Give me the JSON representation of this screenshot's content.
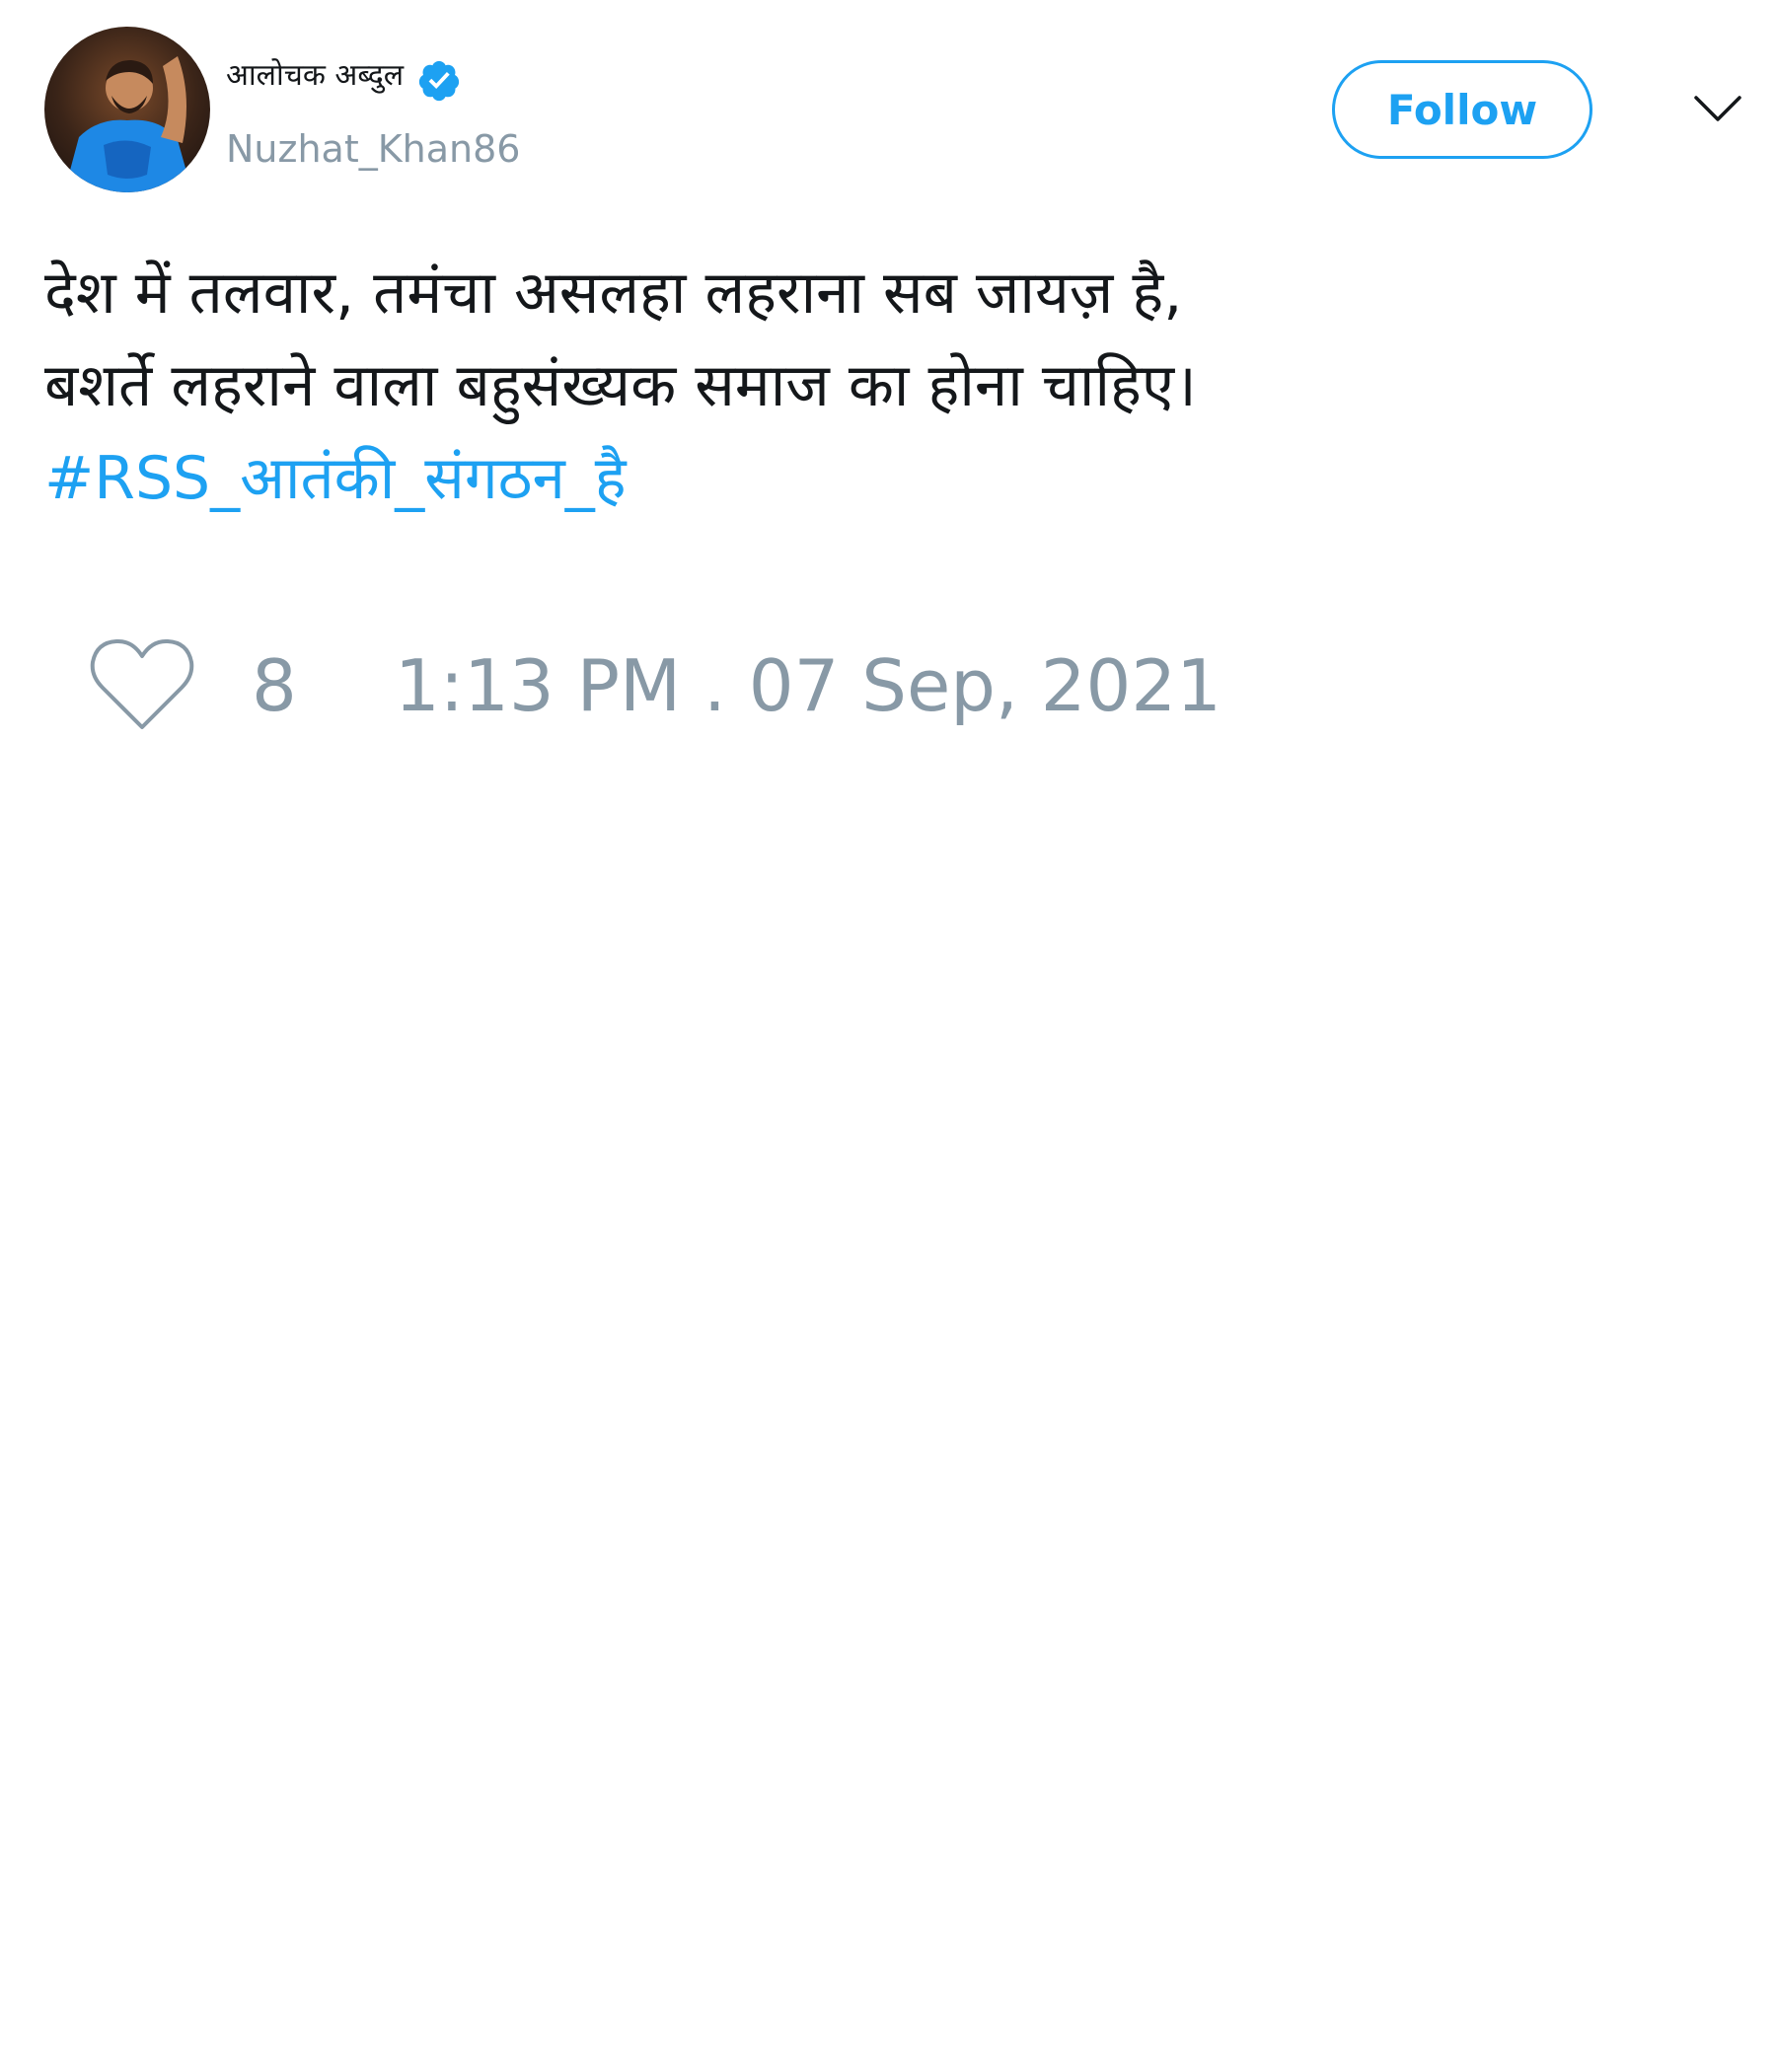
{
  "author": {
    "display_name": "आलोचक अब्दुल",
    "handle": "Nuzhat_Khan86",
    "verified": true,
    "avatar_icon": "user-photo-icon"
  },
  "header": {
    "follow_label": "Follow",
    "menu_icon": "chevron-down-icon"
  },
  "tweet": {
    "lines": [
      "देश में तलवार, तमंचा असलहा लहराना सब जायज़ है,",
      "बशर्ते लहराने वाला बहुसंख्यक समाज का होना चाहिए।"
    ],
    "hashtag": "#RSS_आतंकी_संगठन_है"
  },
  "footer": {
    "like_icon": "heart-outline-icon",
    "like_count": "8",
    "timestamp": "1:13 PM . 07 Sep, 2021"
  },
  "colors": {
    "accent": "#1da1f2",
    "muted": "#8899a6",
    "text": "#14171a"
  }
}
